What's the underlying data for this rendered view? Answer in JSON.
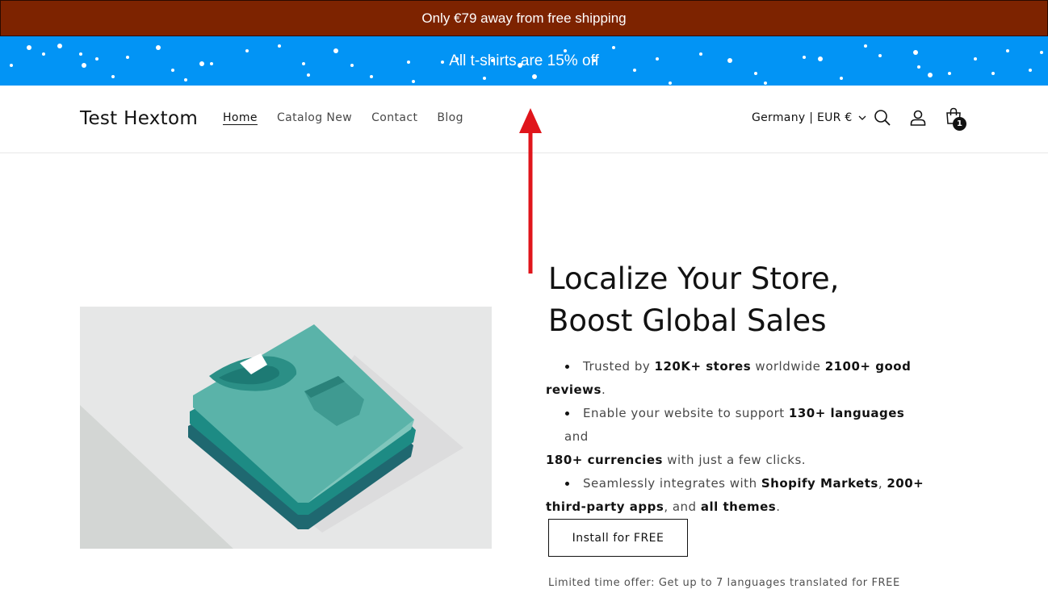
{
  "announcement": {
    "shipping_text": "Only €79 away from free shipping",
    "promo_text": "All t-shirts are 15% off",
    "shipping_bg": "#7d2300",
    "promo_bg": "#0294f5"
  },
  "header": {
    "logo": "Test Hextom",
    "nav": [
      {
        "label": "Home",
        "active": true
      },
      {
        "label": "Catalog New",
        "active": false
      },
      {
        "label": "Contact",
        "active": false
      },
      {
        "label": "Blog",
        "active": false
      }
    ],
    "locale": "Germany | EUR €",
    "cart_count": "1",
    "icons": [
      "search-icon",
      "account-icon",
      "cart-icon",
      "chevron-down-icon"
    ]
  },
  "hero": {
    "title_line1": "Localize Your Store,",
    "title_line2": "Boost Global Sales",
    "features": [
      {
        "t1": "Trusted by ",
        "b1": "120K+ stores",
        "t2": " worldwide ",
        "b2": "2100+ good",
        "b3": "reviews",
        "t3": "."
      },
      {
        "t1": "Enable your website to support ",
        "b1": "130+ languages",
        "t2": " and",
        "b2": "180+ currencies",
        "t3": " with just a few clicks."
      },
      {
        "t1": "Seamlessly integrates with ",
        "b1": "Shopify Markets",
        "t2": ", ",
        "b2": "200+",
        "b3": "third-party apps",
        "t3": ", and ",
        "b4": "all themes",
        "t4": "."
      }
    ],
    "button_label": "Install for FREE",
    "offer_text": "Limited time offer: Get up to 7 languages translated for FREE"
  },
  "annotation": {
    "arrow_color": "#e0151b"
  }
}
